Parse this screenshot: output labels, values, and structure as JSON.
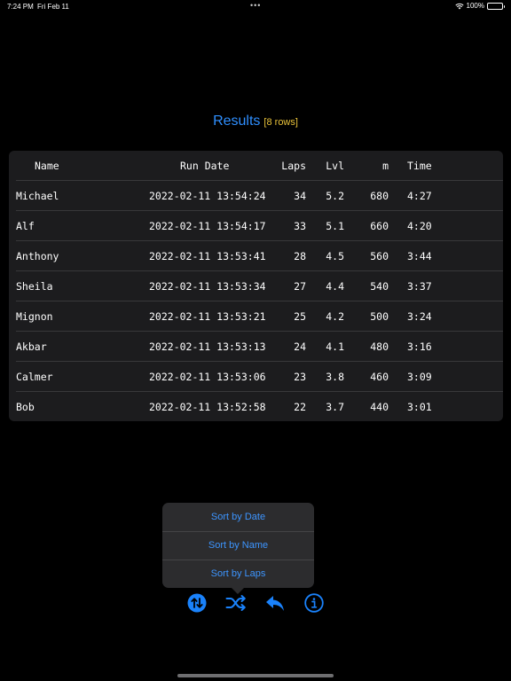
{
  "status_bar": {
    "time": "7:24 PM",
    "date": "Fri Feb 11",
    "battery": "100%",
    "icons": [
      "wifi-icon",
      "battery-icon"
    ]
  },
  "title": {
    "label": "Results",
    "row_count": "[8 rows]",
    "color": "#2f8fff",
    "count_color": "#e9c23a"
  },
  "table": {
    "headers": {
      "name": "Name",
      "date": "Run Date",
      "laps": "Laps",
      "lvl": "Lvl",
      "m": "m",
      "time": "Time"
    },
    "rows": [
      {
        "name": "Michael",
        "date": "2022-02-11 13:54:24",
        "laps": "34",
        "lvl": "5.2",
        "m": "680",
        "time": "4:27"
      },
      {
        "name": "Alf",
        "date": "2022-02-11 13:54:17",
        "laps": "33",
        "lvl": "5.1",
        "m": "660",
        "time": "4:20"
      },
      {
        "name": "Anthony",
        "date": "2022-02-11 13:53:41",
        "laps": "28",
        "lvl": "4.5",
        "m": "560",
        "time": "3:44"
      },
      {
        "name": "Sheila",
        "date": "2022-02-11 13:53:34",
        "laps": "27",
        "lvl": "4.4",
        "m": "540",
        "time": "3:37"
      },
      {
        "name": "Mignon",
        "date": "2022-02-11 13:53:21",
        "laps": "25",
        "lvl": "4.2",
        "m": "500",
        "time": "3:24"
      },
      {
        "name": "Akbar",
        "date": "2022-02-11 13:53:13",
        "laps": "24",
        "lvl": "4.1",
        "m": "480",
        "time": "3:16"
      },
      {
        "name": "Calmer",
        "date": "2022-02-11 13:53:06",
        "laps": "23",
        "lvl": "3.8",
        "m": "460",
        "time": "3:09"
      },
      {
        "name": "Bob",
        "date": "2022-02-11 13:52:58",
        "laps": "22",
        "lvl": "3.7",
        "m": "440",
        "time": "3:01"
      }
    ]
  },
  "sort_menu": {
    "items": [
      "Sort by Date",
      "Sort by Name",
      "Sort by Laps"
    ]
  },
  "toolbar": {
    "accent": "#1a82fb",
    "buttons": [
      "sort-icon",
      "shuffle-icon",
      "back-reply-icon",
      "info-icon"
    ]
  }
}
